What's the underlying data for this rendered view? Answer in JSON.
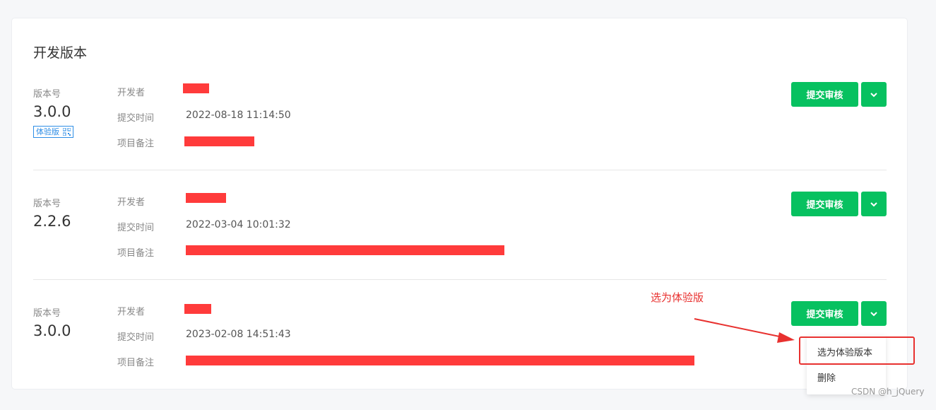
{
  "section_title": "开发版本",
  "labels": {
    "version": "版本号",
    "developer": "开发者",
    "submit_time": "提交时间",
    "remark": "项目备注"
  },
  "versions": [
    {
      "number": "3.0.0",
      "badge": "体验版",
      "submit_time": "2022-08-18 11:14:50",
      "submit_button": "提交审核"
    },
    {
      "number": "2.2.6",
      "submit_time": "2022-03-04 10:01:32",
      "submit_button": "提交审核"
    },
    {
      "number": "3.0.0",
      "submit_time": "2023-02-08 14:51:43",
      "submit_button": "提交审核"
    }
  ],
  "dropdown_menu": {
    "items": [
      "选为体验版本",
      "删除"
    ]
  },
  "annotation": "选为体验版",
  "watermark": "CSDN @h_jQuery",
  "colors": {
    "primary_green": "#07c160",
    "badge_blue": "#2e8ee6",
    "annotation_red": "#e8312f",
    "redaction_red": "#ff3b3b"
  },
  "icons": {
    "dropdown_toggle": "chevron-down-icon",
    "badge_qr": "qr-code-icon"
  }
}
